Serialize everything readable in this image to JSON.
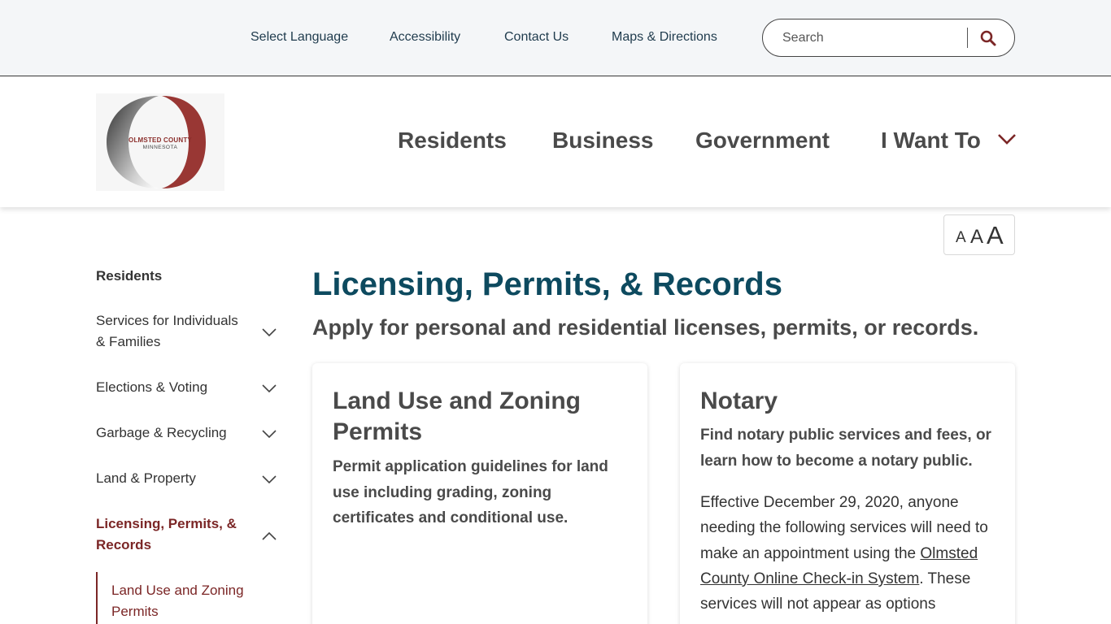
{
  "utility": {
    "select_language": "Select Language",
    "accessibility": "Accessibility",
    "contact_us": "Contact Us",
    "maps_directions": "Maps & Directions",
    "search_placeholder": "Search"
  },
  "logo": {
    "line1": "OLMSTED COUNTY",
    "line2": "MINNESOTA"
  },
  "main_nav": {
    "residents": "Residents",
    "business": "Business",
    "government": "Government",
    "i_want_to": "I Want To"
  },
  "font_size": {
    "small": "A",
    "medium": "A",
    "large": "A"
  },
  "sidebar": {
    "heading": "Residents",
    "items": [
      {
        "label": "Services for Individuals & Families"
      },
      {
        "label": "Elections & Voting"
      },
      {
        "label": "Garbage & Recycling"
      },
      {
        "label": "Land & Property"
      },
      {
        "label": "Licensing, Permits, & Records"
      }
    ],
    "subitems": [
      {
        "label": "Land Use and Zoning Permits"
      }
    ]
  },
  "main": {
    "title": "Licensing, Permits, & Records",
    "subtitle": "Apply for personal and residential licenses, permits, or records.",
    "cards": [
      {
        "title": "Land Use and Zoning Permits",
        "description": "Permit application guidelines for land use including grading, zoning certificates and conditional use."
      },
      {
        "title": "Notary",
        "description": "Find notary public services and fees, or learn how to become a notary public.",
        "body_pre": "Effective December 29, 2020, anyone needing the following services will need to make an appointment using the ",
        "body_link": "Olmsted County Online Check-in System",
        "body_post": ". These services will not appear as options"
      }
    ]
  },
  "colors": {
    "accent": "#7b2626",
    "title": "#0d4a5f",
    "utility_bg": "#f4f6f8"
  }
}
